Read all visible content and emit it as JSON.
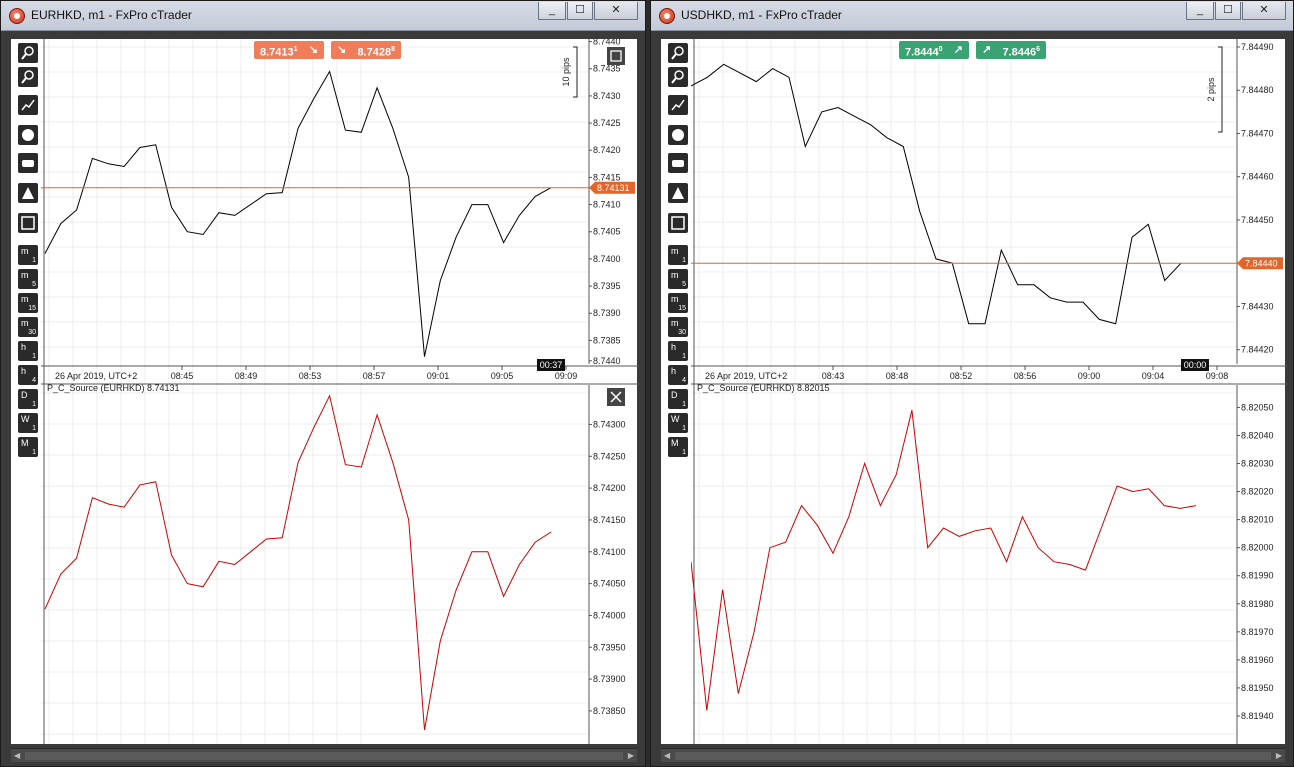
{
  "left": {
    "title": "EURHKD, m1 - FxPro cTrader",
    "window_buttons": [
      "_",
      "☐",
      "✕"
    ],
    "quote": {
      "bid": "8.7413",
      "bid_sup": "1",
      "ask": "8.7428",
      "ask_sup": "8",
      "color": "#f07c5a"
    },
    "pips_label": "10 pips",
    "price_axis": [
      "8.7440",
      "8.7435",
      "8.7430",
      "8.7425",
      "8.7420",
      "8.7415",
      "8.7410",
      "8.7405",
      "8.7400",
      "8.7395",
      "8.7390",
      "8.7385"
    ],
    "current_price": "8.74131",
    "time_axis": [
      "26 Apr 2019, UTC+2",
      "08:45",
      "08:49",
      "08:53",
      "08:57",
      "09:01",
      "09:05",
      "09:09"
    ],
    "countdown": "00:37",
    "indicator_label": "P_C_Source (EURHKD) 8.74131",
    "indicator_axis": [
      "8.7440",
      "8.74300",
      "8.74250",
      "8.74200",
      "8.74150",
      "8.74100",
      "8.74050",
      "8.74000",
      "8.73950",
      "8.73900",
      "8.73850"
    ],
    "price_series": [
      8.7401,
      8.74065,
      8.7409,
      8.74185,
      8.74175,
      8.7417,
      8.74205,
      8.7421,
      8.74095,
      8.7405,
      8.74045,
      8.74085,
      8.7408,
      8.741,
      8.7412,
      8.74122,
      8.7424,
      8.74295,
      8.74345,
      8.74237,
      8.74233,
      8.74315,
      8.7424,
      8.7415,
      8.7382,
      8.7396,
      8.7404,
      8.741,
      8.741,
      8.7403,
      8.7408,
      8.74115,
      8.74131
    ],
    "indicator_series": [
      8.7401,
      8.74065,
      8.7409,
      8.74185,
      8.74175,
      8.7417,
      8.74205,
      8.7421,
      8.74095,
      8.7405,
      8.74045,
      8.74085,
      8.7408,
      8.741,
      8.7412,
      8.74122,
      8.7424,
      8.74295,
      8.74345,
      8.74237,
      8.74233,
      8.74315,
      8.7424,
      8.7415,
      8.7382,
      8.7396,
      8.7404,
      8.741,
      8.741,
      8.7403,
      8.7408,
      8.74115,
      8.74131
    ]
  },
  "right": {
    "title": "USDHKD, m1 - FxPro cTrader",
    "window_buttons": [
      "_",
      "☐",
      "✕"
    ],
    "quote": {
      "bid": "7.8444",
      "bid_sup": "0",
      "ask": "7.8446",
      "ask_sup": "6",
      "color": "#3aa373"
    },
    "pips_label": "2 pips",
    "price_axis": [
      "7.84490",
      "7.84480",
      "7.84470",
      "7.84460",
      "7.84450",
      "7.84440",
      "7.84430",
      "7.84420"
    ],
    "current_price": "7.84440",
    "time_axis": [
      "26 Apr 2019, UTC+2",
      "08:43",
      "08:48",
      "08:52",
      "08:56",
      "09:00",
      "09:04",
      "09:08"
    ],
    "countdown": "00:00",
    "indicator_label": "P_C_Source (EURHKD) 8.82015",
    "indicator_axis": [
      "8.82050",
      "8.82040",
      "8.82030",
      "8.82020",
      "8.82010",
      "8.82000",
      "8.81990",
      "8.81980",
      "8.81970",
      "8.81960",
      "8.81950",
      "8.81940"
    ],
    "price_series": [
      7.84481,
      7.84483,
      7.84486,
      7.84484,
      7.84482,
      7.84485,
      7.84483,
      7.84467,
      7.84475,
      7.84476,
      7.84474,
      7.84472,
      7.84469,
      7.84467,
      7.84452,
      7.84441,
      7.8444,
      7.84426,
      7.84426,
      7.84443,
      7.84435,
      7.84435,
      7.84432,
      7.84431,
      7.84431,
      7.84427,
      7.84426,
      7.84446,
      7.84449,
      7.84436,
      7.8444
    ],
    "indicator_series": [
      8.81995,
      8.81942,
      8.81985,
      8.81948,
      8.8197,
      8.82,
      8.82002,
      8.82015,
      8.82008,
      8.81998,
      8.82011,
      8.8203,
      8.82015,
      8.82026,
      8.82049,
      8.82,
      8.82007,
      8.82004,
      8.82006,
      8.82007,
      8.81995,
      8.82011,
      8.82,
      8.81995,
      8.81994,
      8.81992,
      8.82007,
      8.82022,
      8.8202,
      8.82021,
      8.82015,
      8.82014,
      8.82015
    ]
  },
  "timeframes": [
    {
      "unit": "m",
      "n": "1"
    },
    {
      "unit": "m",
      "n": "5"
    },
    {
      "unit": "m",
      "n": "15"
    },
    {
      "unit": "m",
      "n": "30"
    },
    {
      "unit": "h",
      "n": "1"
    },
    {
      "unit": "h",
      "n": "4"
    },
    {
      "unit": "D",
      "n": "1"
    },
    {
      "unit": "W",
      "n": "1"
    },
    {
      "unit": "M",
      "n": "1"
    }
  ],
  "colors": {
    "price_line": "#000000",
    "indicator_line": "#cc0000",
    "current_price_line": "#e2652a"
  }
}
